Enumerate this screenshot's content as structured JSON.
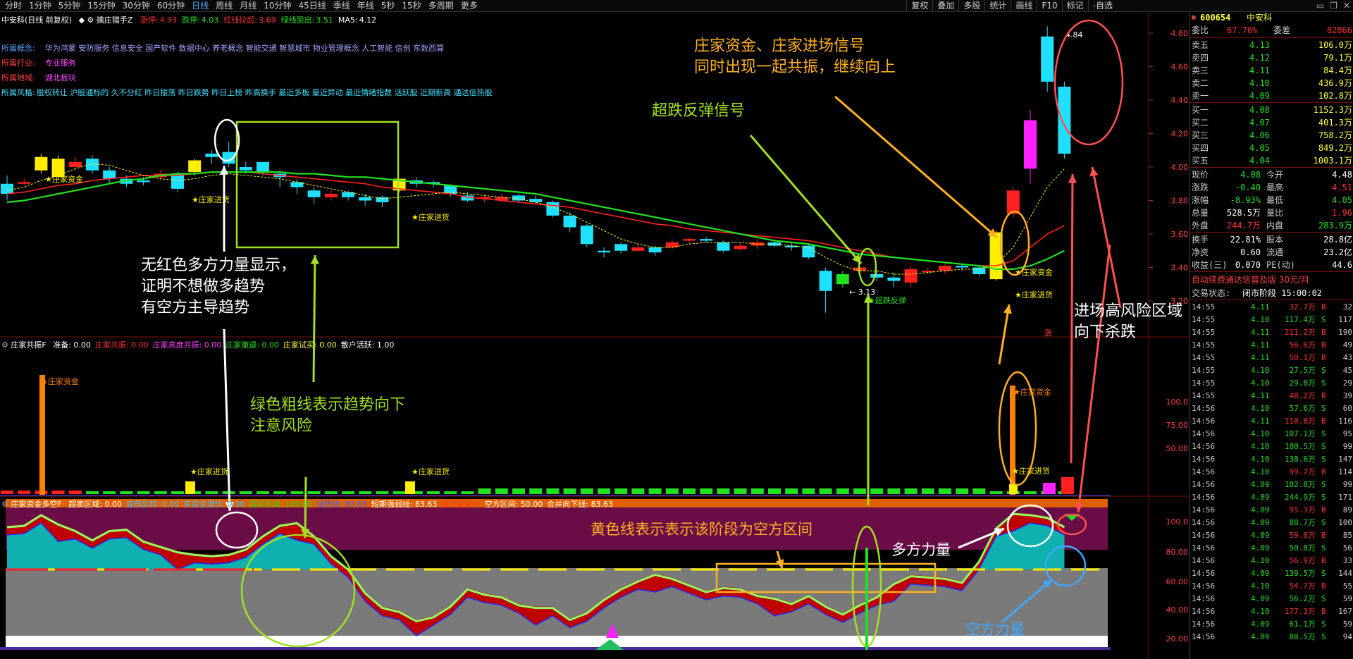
{
  "toolbar": {
    "periods": [
      "分时",
      "1分钟",
      "5分钟",
      "15分钟",
      "30分钟",
      "60分钟",
      "日线",
      "周线",
      "月线",
      "10分钟",
      "45日线",
      "季线",
      "年线",
      "5秒",
      "15秒",
      "多周期",
      "更多"
    ],
    "active_period": "日线",
    "tools": [
      "复权",
      "叠加",
      "多股",
      "统计",
      "画线",
      "F10",
      "标记",
      "-自选"
    ]
  },
  "chart": {
    "title": "中安科(日线 前复权)",
    "indicator_name": "擒庄猎手Z",
    "ind_values": [
      {
        "label": "涨停:",
        "value": "4.93",
        "color": "#ff3030"
      },
      {
        "label": "跌停:",
        "value": "4.03",
        "color": "#20e020"
      },
      {
        "label": "红线拉起:",
        "value": "3.69",
        "color": "#ff3030"
      },
      {
        "label": "绿线脱出:",
        "value": "3.51",
        "color": "#20e020"
      },
      {
        "label": "MA5:",
        "value": "4.12",
        "color": "#ffffff"
      }
    ],
    "info": [
      {
        "label": "所属概念:",
        "value": "华为鸿蒙 安防服务 信息安全 国产软件 数据中心 养老概念 智能交通 智慧城市 物业管理概念 人工智能 信创 东数西算"
      },
      {
        "label": "所属行业:",
        "value": "专业服务"
      },
      {
        "label": "所属地域:",
        "value": "湖北板块"
      },
      {
        "label": "所属风格:",
        "value": "股权转让 沪股通标的 久不分红 昨日振荡 昨日跌势 昨日上榜 昨高换手 最近多板 最近异动 最近情绪指数 活跃股 近期新高 通达信热股"
      }
    ],
    "price_axis": [
      "4.80",
      "4.60",
      "4.40",
      "4.20",
      "4.00",
      "3.80",
      "3.60",
      "3.40",
      "3.20"
    ],
    "high_label": "4.84",
    "low_label": "3.13",
    "marks": {
      "zhuang_money": "★庄家资金",
      "zhuang_in": "★庄家进货",
      "rebound": "★超跌反弹"
    },
    "panel2": {
      "title": "庄家共振F",
      "items": [
        {
          "text": "准备: 0.00",
          "color": "#ffffff"
        },
        {
          "text": "庄家共振: 0.00",
          "color": "#ff3030"
        },
        {
          "text": "庄家高度共振: 0.00",
          "color": "#ff40ff"
        },
        {
          "text": "庄家撤退: 0.00",
          "color": "#20e020"
        },
        {
          "text": "庄家试买: 0.00",
          "color": "#ffff40"
        },
        {
          "text": "散户活跃: 1.00",
          "color": "#ffffff"
        }
      ],
      "axis": [
        "100.0",
        "75.00",
        "50.00"
      ]
    },
    "panel3": {
      "title": "庄家资金多空F",
      "items": [
        {
          "text": "超卖区域: 0.00",
          "color": "#ffffff"
        },
        {
          "text": "底部反转: 0.00",
          "color": "#40c0ff"
        },
        {
          "text": "有资金潜伏: 0.00",
          "color": "#40c0ff"
        },
        {
          "text": "超买区域: 100.00",
          "color": "#20e020"
        },
        {
          "text": "强势线: 83.63",
          "color": "#4060ff"
        },
        {
          "text": "短期强弱线: 83.63",
          "color": "#ffffff"
        },
        {
          "text": "多方区间: -",
          "color": "#ff3030"
        },
        {
          "text": "空方区间: 50.00",
          "color": "#ffffff"
        },
        {
          "text": "合并向下线: 83.63",
          "color": "#ffffff"
        }
      ],
      "axis": [
        "100.0",
        "80.00",
        "60.00",
        "40.00",
        "20.00"
      ]
    },
    "side_marker": "涨"
  },
  "annotations": {
    "a1": [
      "庄家资金、庄家进场信号",
      "同时出现一起共振，继续向上"
    ],
    "a2": "超跌反弹信号",
    "a3": [
      "无红色多方力量显示，",
      "证明不想做多趋势",
      "有空方主导趋势"
    ],
    "a4": [
      "绿色粗线表示趋势向下",
      "注意风险"
    ],
    "a5": "黄色线表示表示该阶段为空方区间",
    "a6": "多方力量",
    "a7": "空方力量",
    "a8": [
      "进场高风险区域",
      "向下杀跌"
    ]
  },
  "quote": {
    "code": "600654",
    "name": "中安科",
    "webi": {
      "label": "委比",
      "pct": "67.76%",
      "label2": "委差",
      "value": "82866"
    },
    "asks": [
      {
        "label": "卖五",
        "price": "4.13",
        "vol": "106.0万"
      },
      {
        "label": "卖四",
        "price": "4.12",
        "vol": "79.1万"
      },
      {
        "label": "卖三",
        "price": "4.11",
        "vol": "84.4万"
      },
      {
        "label": "卖二",
        "price": "4.10",
        "vol": "436.9万"
      },
      {
        "label": "卖一",
        "price": "4.09",
        "vol": "102.8万"
      }
    ],
    "bids": [
      {
        "label": "买一",
        "price": "4.08",
        "vol": "1152.3万"
      },
      {
        "label": "买二",
        "price": "4.07",
        "vol": "401.3万"
      },
      {
        "label": "买三",
        "price": "4.06",
        "vol": "758.2万"
      },
      {
        "label": "买四",
        "price": "4.05",
        "vol": "849.2万"
      },
      {
        "label": "买五",
        "price": "4.04",
        "vol": "1003.1万"
      }
    ],
    "stats": [
      {
        "l1": "现价",
        "v1": "4.08",
        "c1": "#20e020",
        "l2": "今开",
        "v2": "4.48",
        "c2": "#ffffff"
      },
      {
        "l1": "涨跌",
        "v1": "-0.40",
        "c1": "#20e020",
        "l2": "最高",
        "v2": "4.51",
        "c2": "#ff3030"
      },
      {
        "l1": "涨幅",
        "v1": "-8.93%",
        "c1": "#20e020",
        "l2": "最低",
        "v2": "4.05",
        "c2": "#20e020"
      },
      {
        "l1": "总量",
        "v1": "528.5万",
        "c1": "#ffffff",
        "l2": "量比",
        "v2": "1.96",
        "c2": "#ff3030"
      },
      {
        "l1": "外盘",
        "v1": "244.7万",
        "c1": "#ff3030",
        "l2": "内盘",
        "v2": "283.9万",
        "c2": "#20e020"
      },
      {
        "l1": "换手",
        "v1": "22.81%",
        "c1": "#ffffff",
        "l2": "股本",
        "v2": "28.8亿",
        "c2": "#ffffff"
      },
      {
        "l1": "净资",
        "v1": "0.60",
        "c1": "#ffffff",
        "l2": "流通",
        "v2": "23.2亿",
        "c2": "#ffffff"
      },
      {
        "l1": "收益(三)",
        "v1": "0.070",
        "c1": "#ffffff",
        "l2": "PE(动)",
        "v2": "44.6",
        "c2": "#ffffff"
      }
    ],
    "promo": "自动续费通达信普及版 30元/月",
    "status_label": "交易状态:",
    "status_value": "闭市阶段 15:00:02",
    "ticks": [
      [
        "14:55",
        "4.11",
        "32.7万",
        "B",
        "32"
      ],
      [
        "14:55",
        "4.10",
        "117.4万",
        "S",
        "117"
      ],
      [
        "14:55",
        "4.11",
        "211.2万",
        "B",
        "190"
      ],
      [
        "14:55",
        "4.11",
        "56.6万",
        "B",
        "49"
      ],
      [
        "14:55",
        "4.11",
        "50.1万",
        "B",
        "43"
      ],
      [
        "14:55",
        "4.10",
        "27.5万",
        "S",
        "45"
      ],
      [
        "14:55",
        "4.10",
        "29.8万",
        "S",
        "29"
      ],
      [
        "14:55",
        "4.11",
        "48.2万",
        "B",
        "39"
      ],
      [
        "14:56",
        "4.10",
        "57.6万",
        "S",
        "60"
      ],
      [
        "14:56",
        "4.11",
        "110.8万",
        "B",
        "116"
      ],
      [
        "14:56",
        "4.10",
        "107.1万",
        "S",
        "95"
      ],
      [
        "14:56",
        "4.10",
        "100.5万",
        "S",
        "99"
      ],
      [
        "14:56",
        "4.10",
        "138.6万",
        "S",
        "147"
      ],
      [
        "14:56",
        "4.10",
        "99.7万",
        "B",
        "114"
      ],
      [
        "14:56",
        "4.09",
        "102.8万",
        "S",
        "99"
      ],
      [
        "14:56",
        "4.09",
        "244.9万",
        "S",
        "171"
      ],
      [
        "14:56",
        "4.09",
        "95.3万",
        "B",
        "89"
      ],
      [
        "14:56",
        "4.09",
        "88.7万",
        "S",
        "100"
      ],
      [
        "14:56",
        "4.09",
        "59.6万",
        "B",
        "85"
      ],
      [
        "14:56",
        "4.09",
        "50.8万",
        "S",
        "56"
      ],
      [
        "14:56",
        "4.10",
        "56.9万",
        "B",
        "33"
      ],
      [
        "14:56",
        "4.09",
        "139.5万",
        "S",
        "144"
      ],
      [
        "14:56",
        "4.10",
        "54.7万",
        "B",
        "55"
      ],
      [
        "14:56",
        "4.09",
        "56.2万",
        "S",
        "59"
      ],
      [
        "14:56",
        "4.10",
        "177.3万",
        "B",
        "167"
      ],
      [
        "14:56",
        "4.09",
        "61.1万",
        "S",
        "59"
      ],
      [
        "14:56",
        "4.09",
        "88.5万",
        "S",
        "94"
      ]
    ]
  }
}
